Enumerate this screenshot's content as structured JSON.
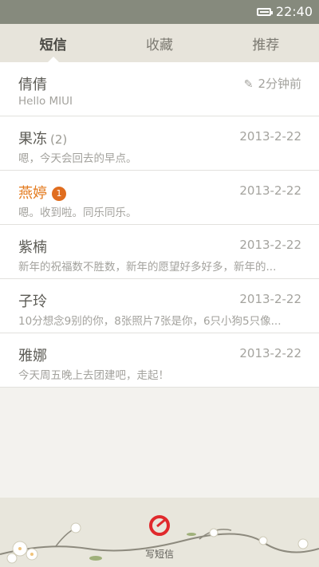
{
  "status": {
    "time": "22:40",
    "battery_level": 0.8
  },
  "tabs": [
    {
      "label": "短信",
      "active": true
    },
    {
      "label": "收藏",
      "active": false
    },
    {
      "label": "推荐",
      "active": false
    }
  ],
  "conversations": [
    {
      "name": "倩倩",
      "time": "2分钟前",
      "preview": "Hello MIUI",
      "draft": true
    },
    {
      "name": "果冻",
      "count": "(2)",
      "time": "2013-2-22",
      "preview": "嗯，今天会回去的早点。"
    },
    {
      "name": "燕婷",
      "badge": "1",
      "time": "2013-2-22",
      "preview": "嗯。收到啦。同乐同乐。"
    },
    {
      "name": "紫楠",
      "time": "2013-2-22",
      "preview": "新年的祝福数不胜数，新年的愿望好多好多，新年的..."
    },
    {
      "name": "子玲",
      "time": "2013-2-22",
      "preview": "10分想念9别的你，8张照片7张是你，6只小狗5只像..."
    },
    {
      "name": "雅娜",
      "time": "2013-2-22",
      "preview": "今天周五晚上去团建吧，走起！"
    }
  ],
  "bottom": {
    "compose_label": "写短信",
    "accent": "#e0292c"
  },
  "colors": {
    "unread": "#e37a1d",
    "badge": "#e06d1f",
    "status_bar": "#868a7d"
  }
}
